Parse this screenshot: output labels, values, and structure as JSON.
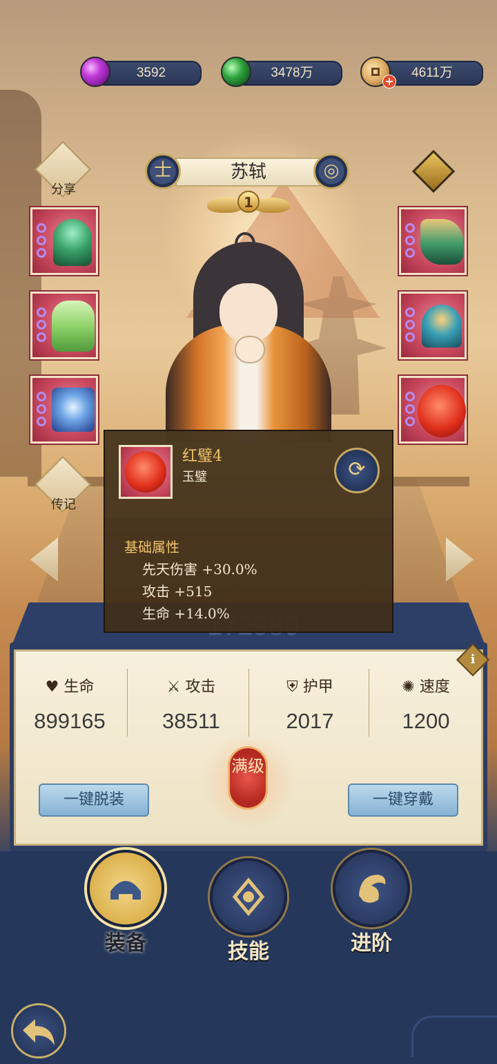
{
  "currencies": [
    {
      "name": "purple-gem",
      "value": "3592"
    },
    {
      "name": "green-jade",
      "value": "3478万"
    },
    {
      "name": "copper-coin",
      "value": "4611万"
    }
  ],
  "hero": {
    "name": "苏轼",
    "level": "1"
  },
  "side_buttons": {
    "share": "分享",
    "biography": "传记"
  },
  "equipment": {
    "left": [
      "staff",
      "robe",
      "book"
    ],
    "right": [
      "boots",
      "accessory",
      "jade"
    ]
  },
  "tooltip": {
    "item_name": "红璧4",
    "item_type": "玉璧",
    "section_title": "基础属性",
    "attributes": [
      "先天伤害 +30.0%",
      "攻击 +515",
      "生命 +14.0%"
    ]
  },
  "power": "172980",
  "stats": [
    {
      "label": "生命",
      "value": "899165",
      "icon": "heart-icon"
    },
    {
      "label": "攻击",
      "value": "38511",
      "icon": "swords-icon"
    },
    {
      "label": "护甲",
      "value": "2017",
      "icon": "shield-icon"
    },
    {
      "label": "速度",
      "value": "1200",
      "icon": "swirl-icon"
    }
  ],
  "actions": {
    "unequip_all": "一键脱装",
    "equip_all": "一键穿戴"
  },
  "max_level_badge": "满级",
  "nav": [
    {
      "label": "装备",
      "active": true
    },
    {
      "label": "技能",
      "active": false
    },
    {
      "label": "进阶",
      "active": false
    }
  ],
  "colors": {
    "panel_blue": "#2c3d63",
    "gold": "#f0c46a",
    "slot_red": "#c9495f"
  }
}
